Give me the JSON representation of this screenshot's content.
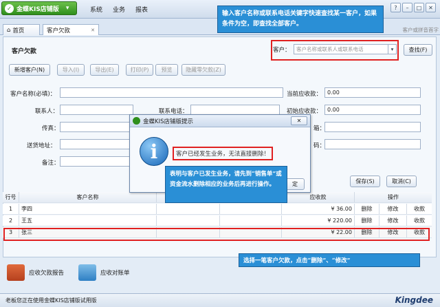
{
  "app": {
    "name": "金蝶KIS店铺版",
    "menu": [
      "系统",
      "业务",
      "报表"
    ]
  },
  "tabs": {
    "home": "首页",
    "current": "客户欠款"
  },
  "search_hint": "客户或拼音首字",
  "page": {
    "title": "客户欠款",
    "customer_label": "客户：",
    "customer_placeholder": "客户名称或联系人或联系电话",
    "search_button": "查找(F)"
  },
  "toolbar": {
    "new": "新增客户(N)",
    "import": "导入(I)",
    "export": "导出(E)",
    "print": "打印(P)",
    "preview": "预览",
    "hide_zero": "隐藏零欠款(Z)"
  },
  "form": {
    "name_label": "客户名称(必填)：",
    "contact_label": "联系人：",
    "phone_label": "联系电话：",
    "fax_label": "传真：",
    "address_label": "送货地址：",
    "remark_label": "备注：",
    "prev_receivable_label": "当前应收款：",
    "prev_receivable_value": "0.00",
    "init_receivable_label": "初始应收款：",
    "init_receivable_value": "0.00",
    "right_label_3": "箱：",
    "right_label_4": "码：",
    "save": "保存(S)",
    "cancel": "取消(C)"
  },
  "table": {
    "headers": {
      "row": "行号",
      "name": "客户名称",
      "receivable": "应收款",
      "ops": "操作"
    },
    "rows": [
      {
        "no": "1",
        "name": "李四",
        "amount": "¥ 36.00",
        "del": "删除",
        "edit": "修改",
        "collect": "收款"
      },
      {
        "no": "2",
        "name": "王五",
        "amount": "¥ 220.00",
        "del": "删除",
        "edit": "修改",
        "collect": "收款"
      },
      {
        "no": "3",
        "name": "张三",
        "amount": "¥ 22.00",
        "del": "删除",
        "edit": "修改",
        "collect": "收款"
      }
    ]
  },
  "dialog": {
    "title": "金蝶KIS店铺版提示",
    "message": "客户已经发生业务，无法直接删除！"
  },
  "callouts": {
    "top": "输入客户名称或联系电话关键字快速查找某一客户，如果条件为空，即查找全部客户。",
    "middle": "表明与客户已发生业务，请先到“销售单”或资金流水删除相应的业务后再进行操作。",
    "bottom": "选择一笔客户欠款，点击“删除”、“修改”"
  },
  "bottom": {
    "report1": "应收欠款报告",
    "report2": "应收对账单"
  },
  "status": {
    "text": "老板您正在使用金蝶KIS店铺版试用版",
    "logo": "Kingdee"
  },
  "colors": {
    "accent": "#2a8fd6",
    "highlight": "#e02020",
    "brand": "#2f8f1c"
  }
}
